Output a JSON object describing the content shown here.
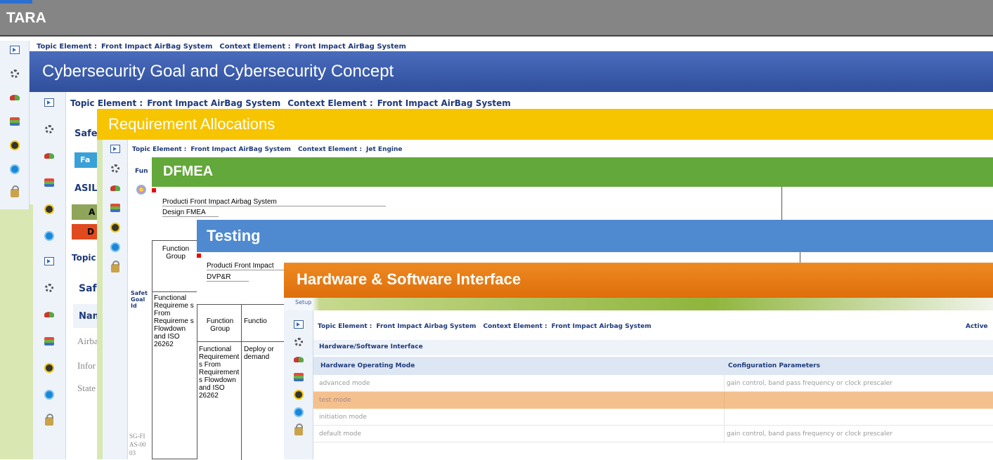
{
  "tara": {
    "title": "TARA",
    "topic_label": "Topic Element :",
    "topic_value": "Front Impact AirBag System",
    "context_label": "Context Element :",
    "context_value": "Front Impact AirBag System"
  },
  "cyber": {
    "title": "Cybersecurity Goal and Cybersecurity Concept",
    "topic_label": "Topic Element :",
    "topic_value": "Front Impact AirBag System",
    "context_label": "Context Element :",
    "context_value": "Front Impact AirBag System",
    "safe_label": "Safe",
    "fa_label": "Fa",
    "asil_label": "ASIL",
    "asil_a": "A",
    "asil_d": "D",
    "topic_short": "Topic",
    "safe2_label": "Safe",
    "name_header": "Nan",
    "rows": [
      "Airba",
      "Infor",
      "State"
    ]
  },
  "req": {
    "title": "Requirement Allocations",
    "topic_label": "Topic Element :",
    "topic_value": "Front Impact AirBag System",
    "context_label": "Context Element :",
    "context_value": "Jet Engine",
    "fun_label": "Fun",
    "safety_goal": "Safet Goal Id",
    "sg_id": "SG-FIAS-0003"
  },
  "dfmea": {
    "title": "DFMEA",
    "product_line1": "Producti Front Impact Airbag System",
    "product_line2": "Design FMEA",
    "function_group": "Function Group",
    "func_req": "Functional Requireme s From Requireme s Flowdown and ISO 26262"
  },
  "testing": {
    "title": "Testing",
    "product_line1": "Producti Front Impact",
    "product_line2": "DVP&R",
    "function_group": "Function Group",
    "function_short": "Functio",
    "func_req": "Functional Requirement s From Requirement s Flowdown and ISO 26262",
    "deploy": "Deploy or demand"
  },
  "hw": {
    "title": "Hardware & Software Interface",
    "setup": "Setup",
    "topic_label": "Topic Element :",
    "topic_value": "Front Impact Airbag System",
    "context_label": "Context Element :",
    "context_value": "Front Impact Airbag System",
    "active": "Active",
    "section": "Hardware/Software Interface",
    "col1": "Hardware Operating Mode",
    "col2": "Configuration Parameters",
    "rows": [
      {
        "mode": "advanced mode",
        "params": "gain control, band pass frequency or clock prescaler"
      },
      {
        "mode": "test mode",
        "params": ""
      },
      {
        "mode": "initiation mode",
        "params": ""
      },
      {
        "mode": "default mode",
        "params": "gain control, band pass frequency or clock prescaler"
      }
    ]
  },
  "colors": {
    "tara": "#858585",
    "cyber": "#3c5eb0",
    "req": "#f7c400",
    "dfmea": "#63a83a",
    "testing": "#4f8ad0",
    "hw": "#e67813",
    "highlight_row": "#f4c08e"
  }
}
